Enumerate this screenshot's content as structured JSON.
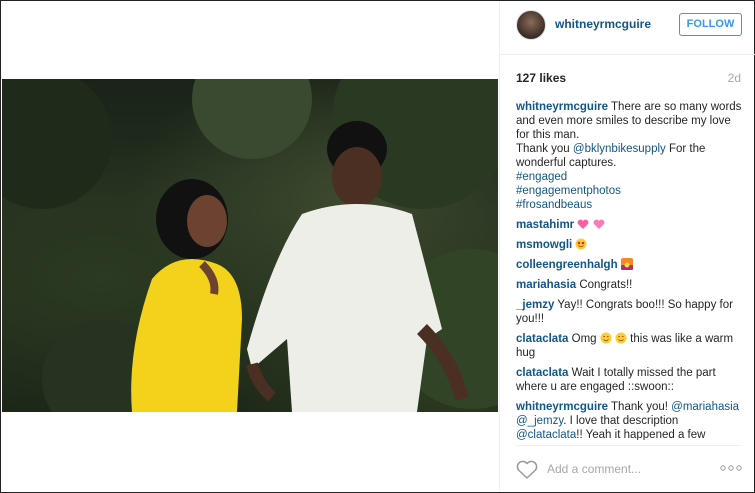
{
  "post": {
    "username": "whitneyrmcguire",
    "follow_label": "FOLLOW",
    "likes": "127 likes",
    "age": "2d"
  },
  "caption": {
    "user": "whitneyrmcguire",
    "text_1": "There are so many words and even more smiles to describe my love for this man.",
    "text_2": "Thank you",
    "mention": "@bklynbikesupply",
    "text_3": "For the wonderful captures.",
    "tags": [
      "#engaged",
      "#engagementphotos",
      "#frosandbeaus"
    ]
  },
  "comments": [
    {
      "user": "mastahimr",
      "text": "",
      "emoji": "sparkling-hearts"
    },
    {
      "user": "msmowgli",
      "text": "",
      "emoji": "heart-eyes-face"
    },
    {
      "user": "colleengreenhalgh",
      "text": "",
      "emoji": "sunset"
    },
    {
      "user": "mariahasia",
      "text": "Congrats!!"
    },
    {
      "user": "_jemzy",
      "text": "Yay!! Congrats boo!!! So happy for you!!!"
    },
    {
      "user": "clataclata",
      "text_a": "Omg",
      "text_b": "this was like a warm hug"
    },
    {
      "user": "clataclata",
      "text": "Wait I totally missed the part where u are engaged ::swoon::"
    },
    {
      "user": "whitneyrmcguire",
      "text_a": "Thank you!",
      "mention_a": "@mariahasia",
      "mention_b": "@_jemzy",
      "text_b": ". I love that description",
      "mention_c": "@clataclata",
      "text_c": "!! Yeah it happened a few"
    }
  ],
  "footer": {
    "add_comment_placeholder": "Add a comment..."
  },
  "colors": {
    "link": "#125688",
    "follow": "#3897f0",
    "muted": "#a5a7aa"
  }
}
